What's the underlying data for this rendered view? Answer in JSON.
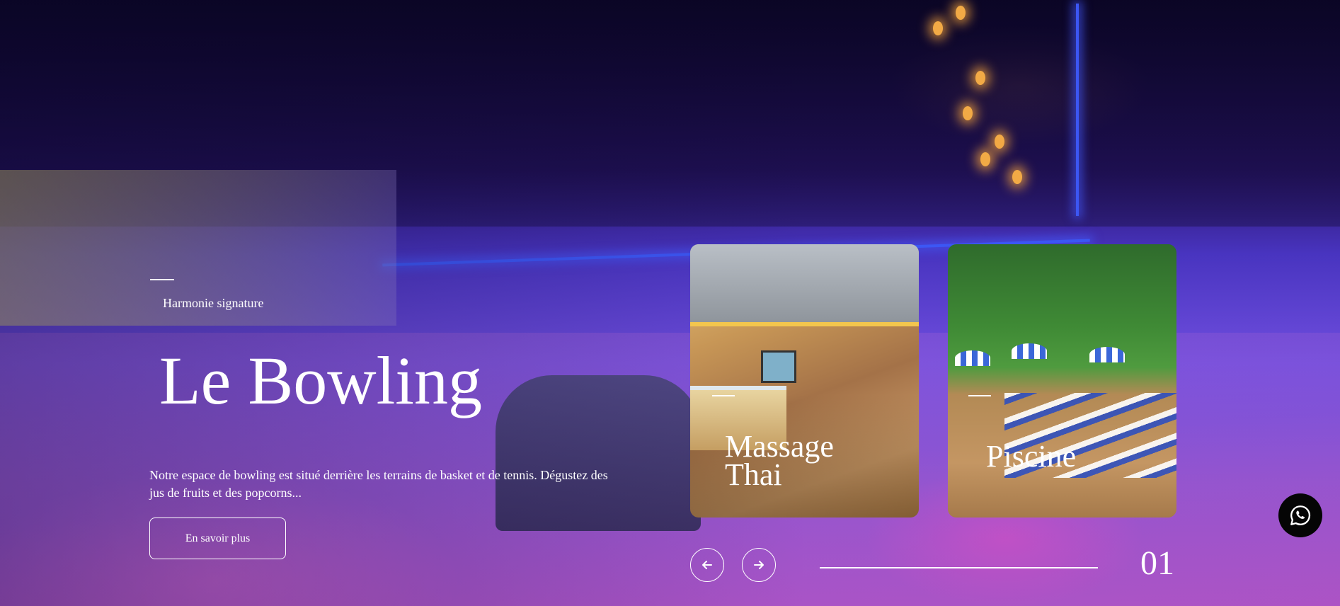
{
  "slide": {
    "eyebrow": "Harmonie signature",
    "title": "Le Bowling",
    "description": "Notre espace de bowling est situé derrière les terrains de basket et de tennis. Dégustez des jus de fruits et des popcorns...",
    "button_label": "En savoir plus"
  },
  "cards": [
    {
      "title": "Massage\nThai"
    },
    {
      "title": "Piscine"
    }
  ],
  "nav": {
    "prev_icon": "arrow-left-icon",
    "next_icon": "arrow-right-icon",
    "counter": "01"
  },
  "whatsapp": {
    "icon": "whatsapp-icon"
  },
  "colors": {
    "neon": "#3f5bff",
    "whatsapp_bg": "#050505"
  }
}
